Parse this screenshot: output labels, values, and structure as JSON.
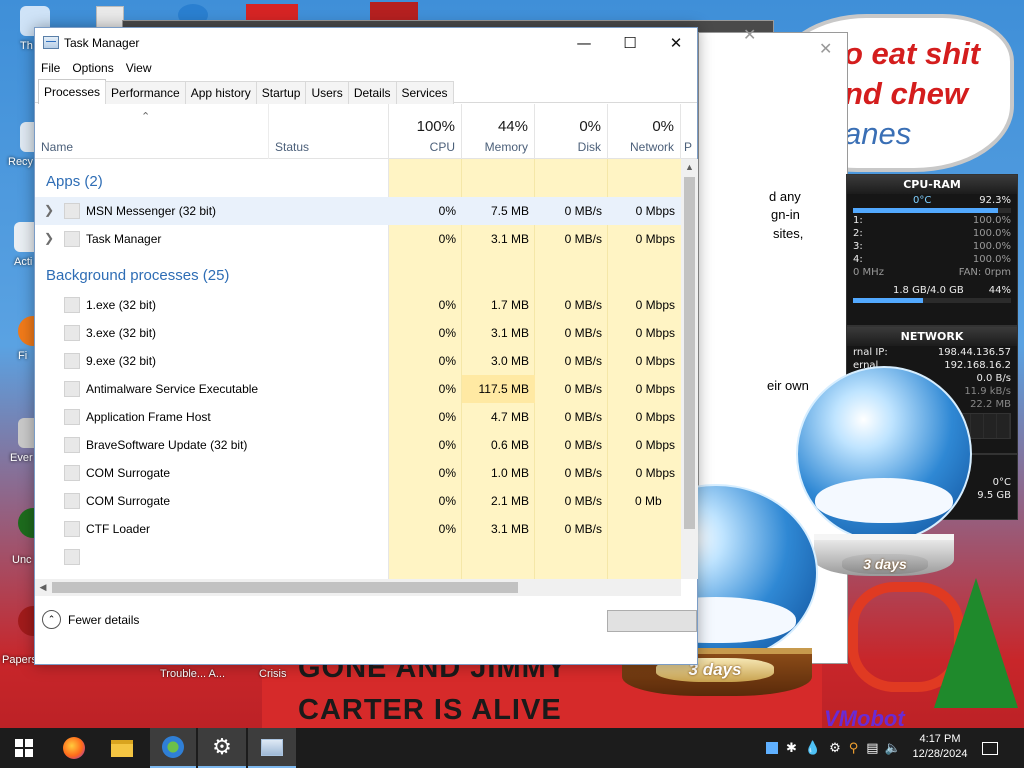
{
  "desktop": {
    "icons": [
      {
        "label": "Th",
        "color": "#cfe3f7"
      },
      {
        "label": "Recy",
        "color": "#dfe9f2"
      },
      {
        "label": "Acti",
        "color": "#e9eef3"
      },
      {
        "label": "Fi",
        "color": "#f07a1a"
      },
      {
        "label": "Ever",
        "color": "#c9c9c9"
      },
      {
        "label": "Unc",
        "color": "#1d6b1d"
      },
      {
        "label": "Papers, P",
        "color": "#a11b1b"
      }
    ],
    "taskbar_labels": [
      "Trouble... A...",
      "Crisis"
    ],
    "speech_lines": [
      "o eat shit",
      "nd chew",
      "anes"
    ],
    "bottom_lines": [
      "GONE AND JIMMY",
      "CARTER IS ALIVE"
    ],
    "bottom_signature": "VMobot",
    "behind_text": [
      "d any",
      "gn-in",
      "sites,",
      "eir own"
    ],
    "globe_plate": "3 days",
    "colors": {
      "accent": "#2e6db5",
      "red": "#c8262a"
    }
  },
  "gadget": {
    "cpu_title": "CPU-RAM",
    "temp": "0°C",
    "total": "92.3%",
    "cores": [
      {
        "label": "1:",
        "value": "100.0%"
      },
      {
        "label": "2:",
        "value": "100.0%"
      },
      {
        "label": "3:",
        "value": "100.0%"
      },
      {
        "label": "4:",
        "value": "100.0%"
      }
    ],
    "freq": "0 MHz",
    "fan": "FAN: 0rpm",
    "mem": "1.8 GB/4.0 GB",
    "mem_pct": "44%",
    "net_title": "NETWORK",
    "ext_label": "rnal IP:",
    "ext_ip": "198.44.136.57",
    "int_label": "ernal",
    "int_ip": "192.168.16.2",
    "down": "0.0 B/s",
    "up": "11.9 kB/s",
    "total_net": "22.2 MB",
    "disk_temp": "0°C",
    "disk_free": "9.5 GB"
  },
  "taskmanager": {
    "title": "Task Manager",
    "menu": [
      "File",
      "Options",
      "View"
    ],
    "tabs": [
      "Processes",
      "Performance",
      "App history",
      "Startup",
      "Users",
      "Details",
      "Services"
    ],
    "columns": {
      "name": "Name",
      "status": "Status",
      "cpu": {
        "pct": "100%",
        "label": "CPU"
      },
      "memory": {
        "pct": "44%",
        "label": "Memory"
      },
      "disk": {
        "pct": "0%",
        "label": "Disk"
      },
      "network": {
        "pct": "0%",
        "label": "Network"
      },
      "power": "P"
    },
    "groups": {
      "apps": "Apps (2)",
      "background": "Background processes (25)"
    },
    "apps": [
      {
        "name": "MSN Messenger (32 bit)",
        "cpu": "0%",
        "mem": "7.5 MB",
        "disk": "0 MB/s",
        "net": "0 Mbps"
      },
      {
        "name": "Task Manager",
        "cpu": "0%",
        "mem": "3.1 MB",
        "disk": "0 MB/s",
        "net": "0 Mbps"
      }
    ],
    "background": [
      {
        "name": "1.exe (32 bit)",
        "cpu": "0%",
        "mem": "1.7 MB",
        "disk": "0 MB/s",
        "net": "0 Mbps"
      },
      {
        "name": "3.exe (32 bit)",
        "cpu": "0%",
        "mem": "3.1 MB",
        "disk": "0 MB/s",
        "net": "0 Mbps"
      },
      {
        "name": "9.exe (32 bit)",
        "cpu": "0%",
        "mem": "3.0 MB",
        "disk": "0 MB/s",
        "net": "0 Mbps"
      },
      {
        "name": "Antimalware Service Executable",
        "cpu": "0%",
        "mem": "117.5 MB",
        "disk": "0 MB/s",
        "net": "0 Mbps"
      },
      {
        "name": "Application Frame Host",
        "cpu": "0%",
        "mem": "4.7 MB",
        "disk": "0 MB/s",
        "net": "0 Mbps"
      },
      {
        "name": "BraveSoftware Update (32 bit)",
        "cpu": "0%",
        "mem": "0.6 MB",
        "disk": "0 MB/s",
        "net": "0 Mbps"
      },
      {
        "name": "COM Surrogate",
        "cpu": "0%",
        "mem": "1.0 MB",
        "disk": "0 MB/s",
        "net": "0 Mbps"
      },
      {
        "name": "COM Surrogate",
        "cpu": "0%",
        "mem": "2.1 MB",
        "disk": "0 MB/s",
        "net": "0 Mb"
      },
      {
        "name": "CTF Loader",
        "cpu": "0%",
        "mem": "3.1 MB",
        "disk": "0 MB/s",
        "net": ""
      }
    ],
    "fewer_details": "Fewer details"
  },
  "taskbar": {
    "clock_time": "4:17 PM",
    "clock_date": "12/28/2024"
  }
}
